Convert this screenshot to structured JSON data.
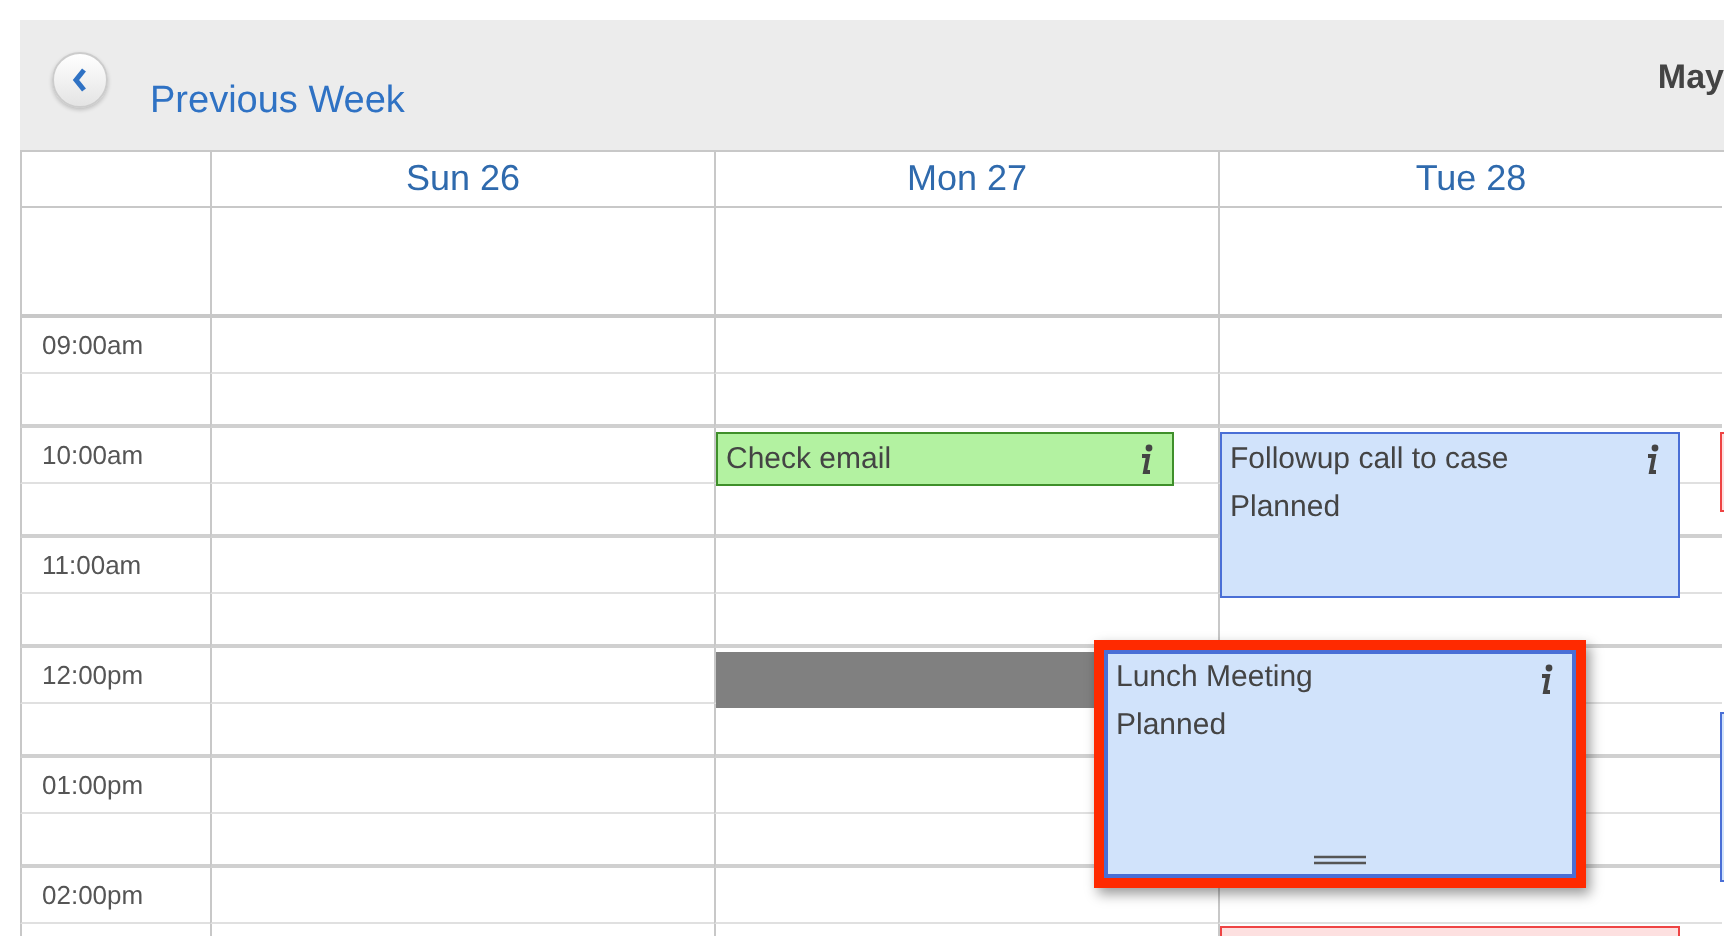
{
  "header": {
    "back_button": {
      "label": "Previous Week"
    },
    "month": "May"
  },
  "days": [
    "Sun 26",
    "Mon 27",
    "Tue 28"
  ],
  "times": [
    "09:00am",
    "10:00am",
    "11:00am",
    "12:00pm",
    "01:00pm",
    "02:00pm"
  ],
  "events": [
    {
      "title": "Check email",
      "color": "#b3f2a1",
      "dragging": false
    },
    {
      "title": "Followup call to case",
      "status": "Planned",
      "color": "#d1e3fb",
      "dragging": false
    },
    {
      "title": "Lunch Meeting",
      "status": "Planned",
      "color": "#d1e3fb",
      "dragging": true
    },
    {
      "color": "#fde0e0",
      "dragging": false
    },
    {
      "color": "#fde0e0",
      "dragging": false
    },
    {
      "color": "#d1e3fb",
      "dragging": false
    }
  ]
}
